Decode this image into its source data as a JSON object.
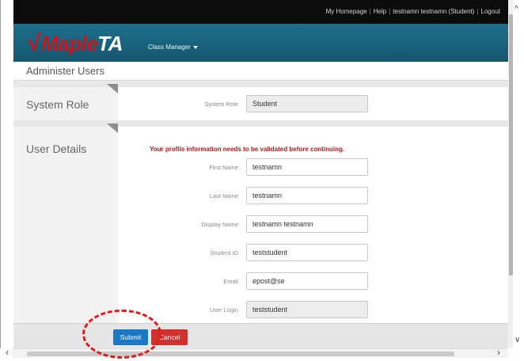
{
  "topbar": {
    "links": [
      "My Homepage",
      "Help",
      "testnamn testnamn (Student)",
      "Logout"
    ],
    "separator": "|"
  },
  "header": {
    "logo_check": "√",
    "logo_maple": "Maple",
    "logo_ta": "TA",
    "menu_label": "Class Manager"
  },
  "page": {
    "title": "Administer Users"
  },
  "system_role_section": {
    "label": "System Role",
    "field_label": "System Role",
    "field_value": "Student"
  },
  "user_details_section": {
    "label": "User Details",
    "warning": "Your profile information needs to be validated before continuing.",
    "fields": [
      {
        "label": "First Name",
        "value": "testnamn",
        "readonly": false
      },
      {
        "label": "Last Name",
        "value": "testnamn",
        "readonly": false
      },
      {
        "label": "Display Name",
        "value": "testnamn testnamn",
        "readonly": false
      },
      {
        "label": "Student ID",
        "value": "teststudent",
        "readonly": false
      },
      {
        "label": "Email",
        "value": "epost@se",
        "readonly": false
      },
      {
        "label": "User Login",
        "value": "teststudent",
        "readonly": true
      }
    ]
  },
  "footer": {
    "submit_label": "Submit",
    "cancel_label": "Cancel"
  },
  "colors": {
    "header_teal": "#1f6f8b",
    "logo_red": "#c4161c",
    "warning_red": "#b21818",
    "submit_blue": "#1b78c5",
    "cancel_red": "#d0302e",
    "annotation_red": "#e01919"
  }
}
